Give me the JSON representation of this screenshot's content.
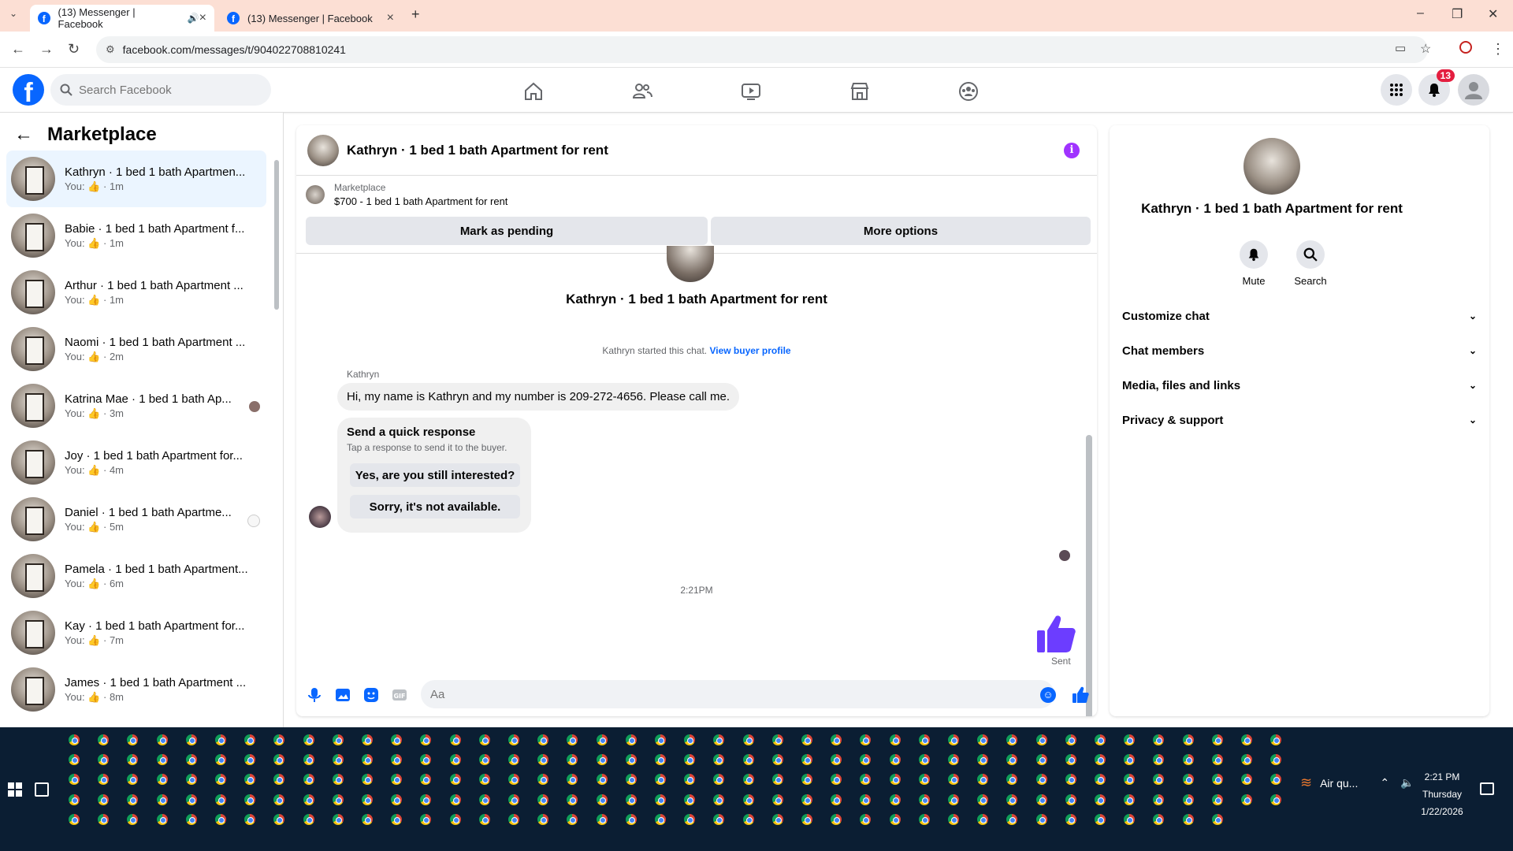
{
  "browser": {
    "tabs": [
      {
        "title": "(13) Messenger | Facebook",
        "active": true
      },
      {
        "title": "(13) Messenger | Facebook",
        "active": false
      }
    ],
    "url": "facebook.com/messages/t/904022708810241"
  },
  "fb": {
    "search_placeholder": "Search Facebook",
    "notifications_count": "13"
  },
  "sidebar": {
    "title": "Marketplace",
    "conversations": [
      {
        "name": "Kathryn · 1 bed 1 bath Apartmen...",
        "you": "You:",
        "time": "· 1m",
        "active": true
      },
      {
        "name": "Babie · 1 bed 1 bath Apartment f...",
        "you": "You:",
        "time": "· 1m"
      },
      {
        "name": "Arthur · 1 bed 1 bath Apartment ...",
        "you": "You:",
        "time": "· 1m"
      },
      {
        "name": "Naomi · 1 bed 1 bath Apartment ...",
        "you": "You:",
        "time": "· 2m"
      },
      {
        "name": "Katrina Mae · 1 bed 1 bath Ap...",
        "you": "You:",
        "time": "· 3m"
      },
      {
        "name": "Joy · 1 bed 1 bath Apartment for...",
        "you": "You:",
        "time": "· 4m"
      },
      {
        "name": "Daniel · 1 bed 1 bath Apartme...",
        "you": "You:",
        "time": "· 5m"
      },
      {
        "name": "Pamela · 1 bed 1 bath Apartment...",
        "you": "You:",
        "time": "· 6m"
      },
      {
        "name": "Kay · 1 bed 1 bath Apartment for...",
        "you": "You:",
        "time": "· 7m"
      },
      {
        "name": "James · 1 bed 1 bath Apartment ...",
        "you": "You:",
        "time": "· 8m"
      }
    ]
  },
  "chat": {
    "title": "Kathryn · 1 bed 1 bath Apartment for rent",
    "marketplace_label": "Marketplace",
    "listing": "$700 - 1 bed 1 bath Apartment for rent",
    "mark_pending": "Mark as pending",
    "more_options": "More options",
    "header_name": "Kathryn · 1 bed 1 bath Apartment for rent",
    "started_text": "Kathryn started this chat.",
    "view_profile": "View buyer profile",
    "sender": "Kathryn",
    "message": "Hi, my name is Kathryn and my number is 209-272-4656. Please call me.",
    "quick_title": "Send a quick response",
    "quick_sub": "Tap a response to send it to the buyer.",
    "quick_1": "Yes, are you still interested?",
    "quick_2": "Sorry, it's not available.",
    "timestamp": "2:21PM",
    "sent": "Sent",
    "input_placeholder": "Aa"
  },
  "right_panel": {
    "name": "Kathryn · 1 bed 1 bath Apartment for rent",
    "mute": "Mute",
    "search": "Search",
    "sections": [
      "Customize chat",
      "Chat members",
      "Media, files and links",
      "Privacy & support"
    ]
  },
  "taskbar": {
    "weather": "Air qu...",
    "time": "2:21 PM",
    "day": "Thursday",
    "date": "1/22/2026"
  }
}
